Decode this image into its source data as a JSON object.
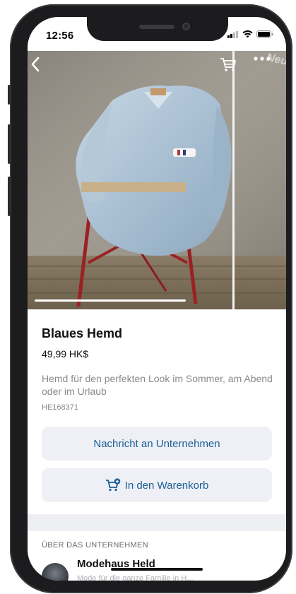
{
  "status_bar": {
    "time": "12:56"
  },
  "product": {
    "badge": "Neu",
    "title": "Blaues Hemd",
    "price": "49,99 HK$",
    "description": "Hemd für den perfekten Look im Sommer, am Abend oder im Urlaub",
    "sku": "HE168371",
    "image_index": 1,
    "image_count": 2
  },
  "actions": {
    "message_label": "Nachricht an Unternehmen",
    "cart_label": "In den Warenkorb"
  },
  "about": {
    "section_label": "ÜBER DAS UNTERNEHMEN",
    "company_name": "Modehaus Held",
    "company_subtitle": "Mode für die ganze Familie in H..."
  },
  "colors": {
    "accent": "#1a5e96",
    "button_bg": "#eef0f5",
    "frame": "#1c1c1e"
  },
  "icons": {
    "back": "chevron-left-icon",
    "cart": "cart-icon",
    "more": "more-icon",
    "add_to_cart": "cart-plus-icon"
  }
}
